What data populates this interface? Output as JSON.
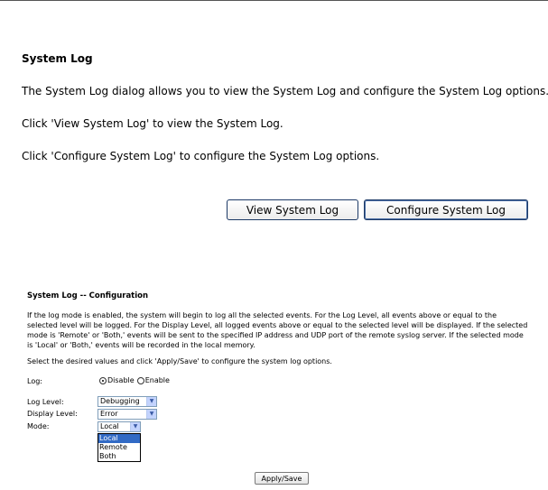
{
  "intro": {
    "title": "System Log",
    "para1": "The System Log dialog allows you to view the System Log and configure the System Log options.",
    "para2": "Click 'View System Log' to view the System Log.",
    "para3": "Click 'Configure System Log' to configure the System Log options.",
    "view_button": "View System Log",
    "configure_button": "Configure System Log"
  },
  "config": {
    "title": "System Log -- Configuration",
    "description": "If the log mode is enabled, the system will begin to log all the selected events. For the Log Level, all events above or equal to the selected level will be logged. For the Display Level, all logged events above or equal to the selected level will be displayed. If the selected mode is 'Remote' or 'Both,' events will be sent to the specified IP address and UDP port of the remote syslog server. If the selected mode is 'Local' or 'Both,' events will be recorded in the local memory.",
    "instruction": "Select the desired values and click 'Apply/Save' to configure the system log options.",
    "log_label": "Log:",
    "log_options": [
      "Disable",
      "Enable"
    ],
    "log_selected": "Disable",
    "log_level_label": "Log Level:",
    "log_level_value": "Debugging",
    "display_level_label": "Display Level:",
    "display_level_value": "Error",
    "mode_label": "Mode:",
    "mode_value": "Local",
    "mode_options": [
      "Local",
      "Remote",
      "Both"
    ],
    "mode_highlighted": "Local",
    "apply_button": "Apply/Save"
  }
}
